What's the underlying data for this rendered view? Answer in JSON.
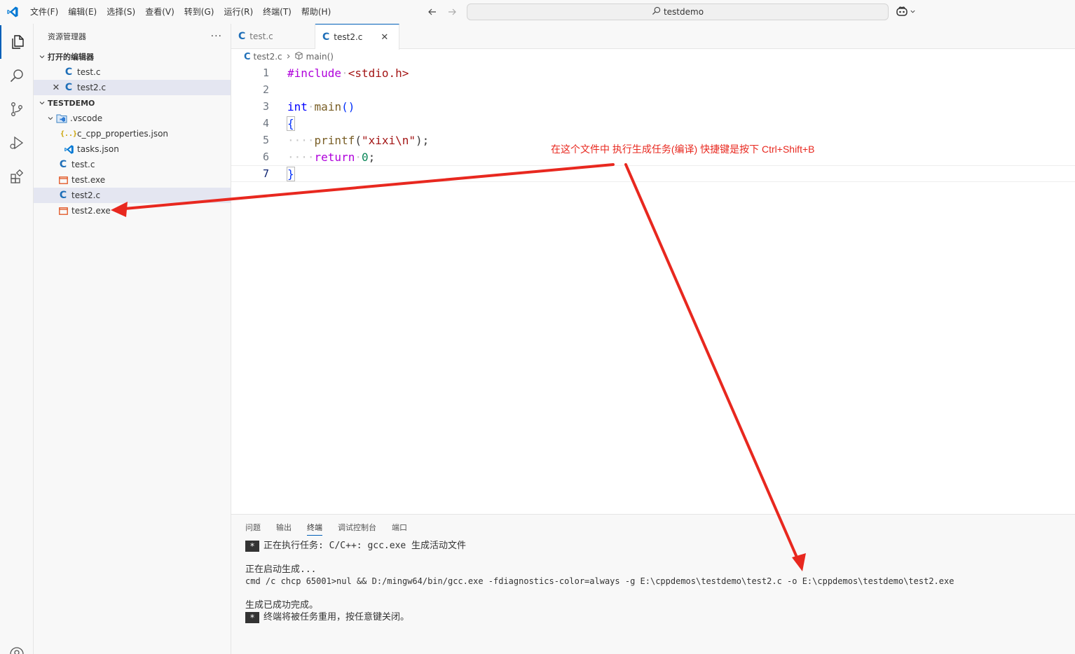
{
  "titlebar": {
    "menu": [
      "文件(F)",
      "编辑(E)",
      "选择(S)",
      "查看(V)",
      "转到(G)",
      "运行(R)",
      "终端(T)",
      "帮助(H)"
    ],
    "search_text": "testdemo"
  },
  "sidebar": {
    "title": "资源管理器",
    "more": "···",
    "open_editors_label": "打开的编辑器",
    "open_editors": [
      {
        "name": "test.c",
        "icon": "c-file-icon"
      },
      {
        "name": "test2.c",
        "icon": "c-file-icon",
        "selected": true
      }
    ],
    "folder_label": "TESTDEMO",
    "tree": [
      {
        "name": ".vscode",
        "icon": "vscode-folder-icon"
      },
      {
        "name": "c_cpp_properties.json",
        "icon": "json-file-icon"
      },
      {
        "name": "tasks.json",
        "icon": "vscode-file-icon"
      },
      {
        "name": "test.c",
        "icon": "c-file-icon"
      },
      {
        "name": "test.exe",
        "icon": "exe-file-icon"
      },
      {
        "name": "test2.c",
        "icon": "c-file-icon",
        "selected": true
      },
      {
        "name": "test2.exe",
        "icon": "exe-file-icon"
      }
    ]
  },
  "editor": {
    "tabs": [
      {
        "label": "test.c",
        "active": false
      },
      {
        "label": "test2.c",
        "active": true
      }
    ],
    "breadcrumb": {
      "file": "test2.c",
      "symbol": "main()"
    },
    "line_numbers": [
      "1",
      "2",
      "3",
      "4",
      "5",
      "6",
      "7"
    ],
    "code": {
      "l1_pre": "#include",
      "l1_inc": "<stdio.h>",
      "l3_kw": "int",
      "l3_fn": "main",
      "l3_paren": "()",
      "l4": "{",
      "l5_fn": "printf",
      "l5_open": "(",
      "l5_str": "\"xixi\\n\"",
      "l5_close": ");",
      "l6_kw": "return",
      "l6_num": "0",
      "l6_end": ";",
      "l7": "}"
    }
  },
  "annotation": "在这个文件中 执行生成任务(编译)  快捷键是按下 Ctrl+Shift+B",
  "panel": {
    "tabs": [
      "问题",
      "输出",
      "终端",
      "调试控制台",
      "端口"
    ],
    "active_tab": "终端",
    "star": "*",
    "lines": {
      "task": "正在执行任务: C/C++: gcc.exe 生成活动文件",
      "starting": "正在启动生成...",
      "cmd": "cmd /c chcp 65001>nul && D:/mingw64/bin/gcc.exe -fdiagnostics-color=always -g E:\\cppdemos\\testdemo\\test2.c -o E:\\cppdemos\\testdemo\\test2.exe",
      "done": "生成已成功完成。",
      "reuse": "终端将被任务重用，按任意键关闭。"
    }
  },
  "colors": {
    "accent": "#005fb8",
    "annotation": "#e8281f",
    "c_icon": "#1f6fb8",
    "exe_icon": "#e0511e"
  }
}
